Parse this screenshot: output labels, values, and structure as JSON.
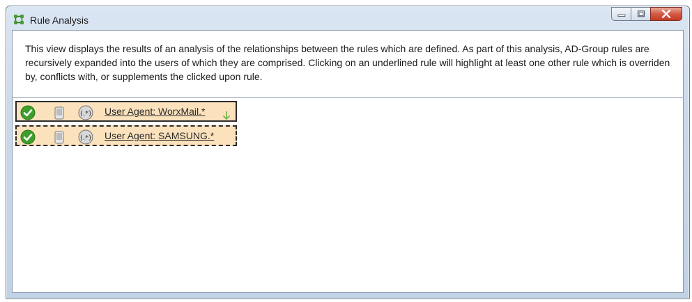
{
  "window": {
    "title": "Rule Analysis",
    "controls": [
      "minimize-icon",
      "maximize-icon",
      "close-icon"
    ]
  },
  "description": "This view displays the results of an analysis of the relationships between the rules which are defined. As part of this analysis, AD-Group rules are recursively expanded into the users of which they are comprised. Clicking on an underlined rule will highlight at least one other rule which is overriden by, conflicts with, or supplements the clicked upon rule.",
  "rules": [
    {
      "label": "User Agent: WorxMail.*",
      "state": "selected",
      "icons": [
        "check-icon",
        "device-icon",
        "regex-icon"
      ],
      "indicator": "arrow-down-icon"
    },
    {
      "label": "User Agent: SAMSUNG.*",
      "state": "related",
      "icons": [
        "check-icon",
        "device-icon",
        "regex-icon"
      ]
    }
  ],
  "colors": {
    "row_highlight": "#fbe2bd",
    "check_green": "#3f9e2b",
    "close_red": "#c43a22"
  }
}
